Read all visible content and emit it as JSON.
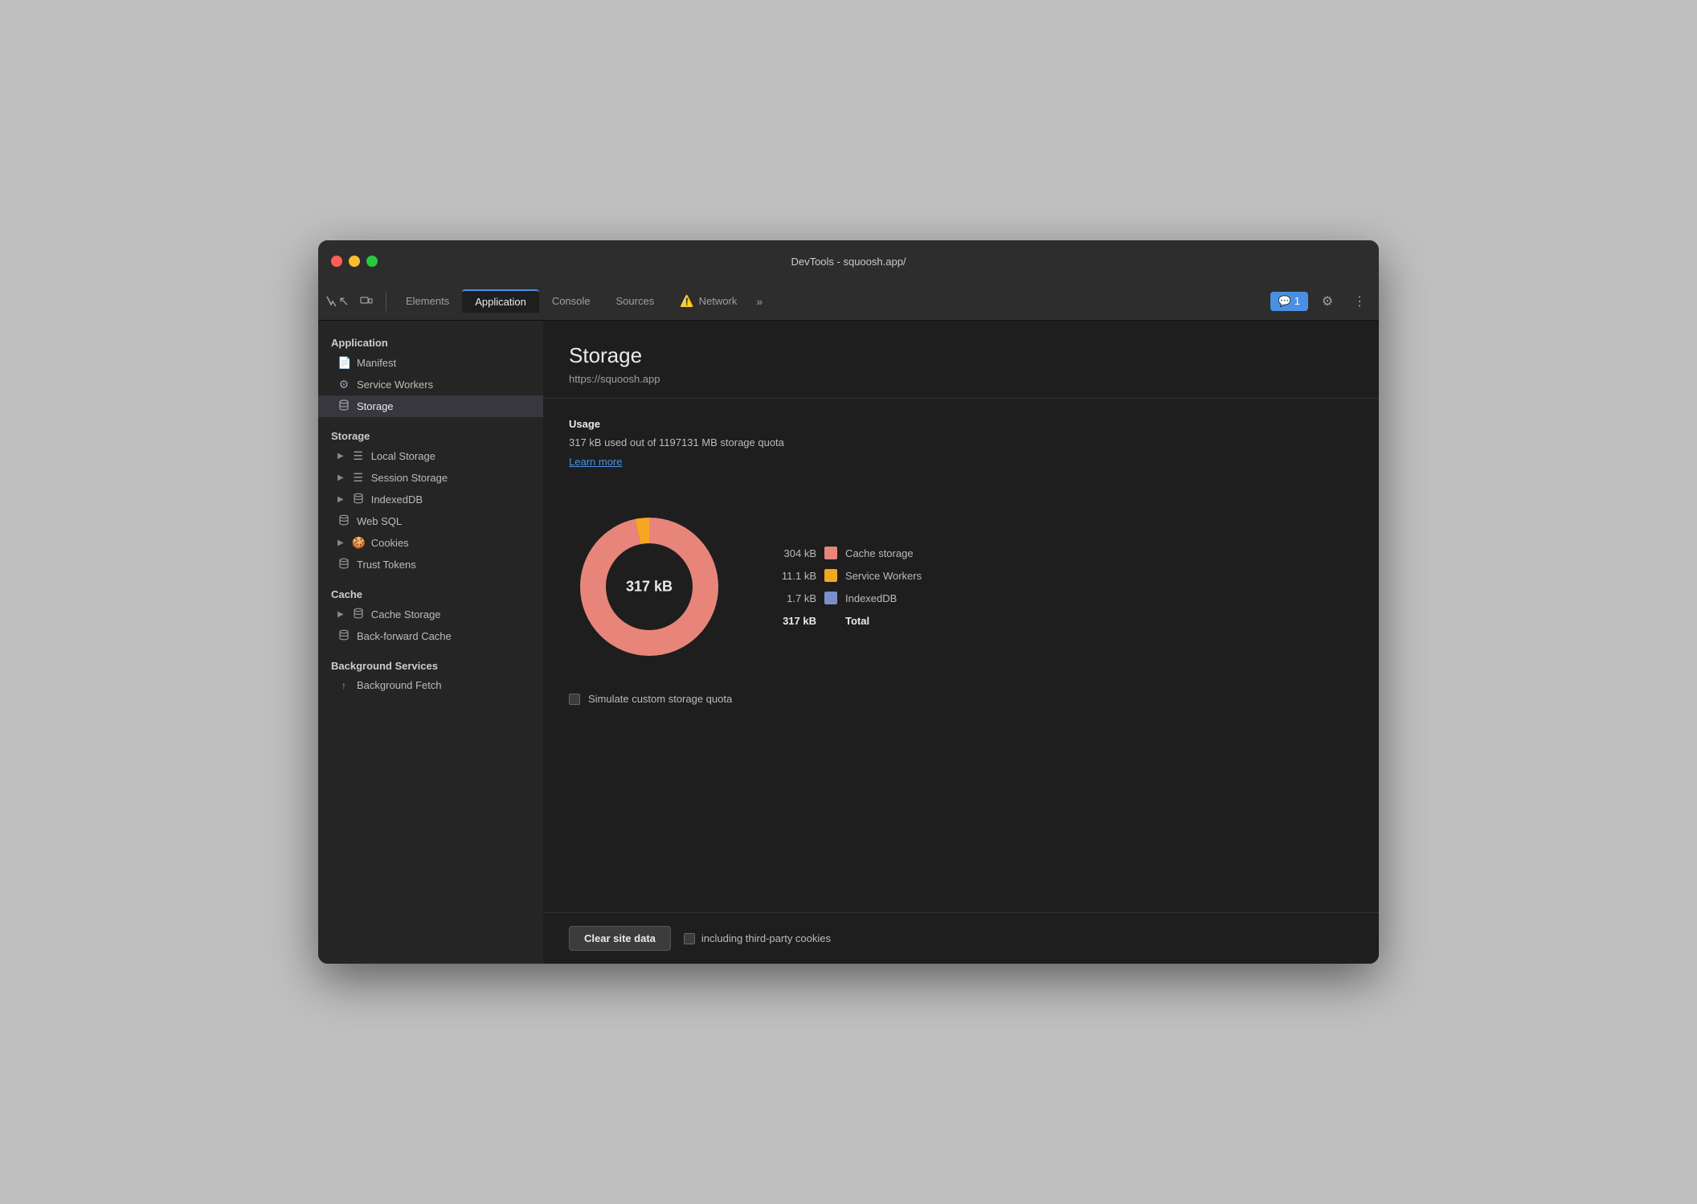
{
  "window": {
    "title": "DevTools - squoosh.app/"
  },
  "toolbar": {
    "tabs": [
      {
        "id": "elements",
        "label": "Elements",
        "active": false,
        "warning": false
      },
      {
        "id": "application",
        "label": "Application",
        "active": true,
        "warning": false
      },
      {
        "id": "console",
        "label": "Console",
        "active": false,
        "warning": false
      },
      {
        "id": "sources",
        "label": "Sources",
        "active": false,
        "warning": false
      },
      {
        "id": "network",
        "label": "Network",
        "active": false,
        "warning": true
      }
    ],
    "more_label": "»",
    "notifications_count": "1",
    "notifications_icon": "💬"
  },
  "sidebar": {
    "sections": [
      {
        "label": "Application",
        "items": [
          {
            "id": "manifest",
            "label": "Manifest",
            "icon": "📄",
            "expandable": false,
            "active": false
          },
          {
            "id": "service-workers",
            "label": "Service Workers",
            "icon": "⚙️",
            "expandable": false,
            "active": false
          },
          {
            "id": "storage-top",
            "label": "Storage",
            "icon": "🗄️",
            "expandable": false,
            "active": true
          }
        ]
      },
      {
        "label": "Storage",
        "items": [
          {
            "id": "local-storage",
            "label": "Local Storage",
            "icon": "☰",
            "expandable": true,
            "active": false
          },
          {
            "id": "session-storage",
            "label": "Session Storage",
            "icon": "☰",
            "expandable": true,
            "active": false
          },
          {
            "id": "indexeddb",
            "label": "IndexedDB",
            "icon": "🗄️",
            "expandable": true,
            "active": false
          },
          {
            "id": "web-sql",
            "label": "Web SQL",
            "icon": "🗄️",
            "expandable": false,
            "active": false
          },
          {
            "id": "cookies",
            "label": "Cookies",
            "icon": "🍪",
            "expandable": true,
            "active": false
          },
          {
            "id": "trust-tokens",
            "label": "Trust Tokens",
            "icon": "🗄️",
            "expandable": false,
            "active": false
          }
        ]
      },
      {
        "label": "Cache",
        "items": [
          {
            "id": "cache-storage",
            "label": "Cache Storage",
            "icon": "🗄️",
            "expandable": true,
            "active": false
          },
          {
            "id": "back-forward-cache",
            "label": "Back-forward Cache",
            "icon": "🗄️",
            "expandable": false,
            "active": false
          }
        ]
      },
      {
        "label": "Background Services",
        "items": [
          {
            "id": "background-fetch",
            "label": "Background Fetch",
            "icon": "↑",
            "expandable": false,
            "active": false
          }
        ]
      }
    ]
  },
  "content": {
    "title": "Storage",
    "url": "https://squoosh.app",
    "usage_label": "Usage",
    "usage_text": "317 kB used out of 1197131 MB storage quota",
    "learn_more": "Learn more",
    "donut_center": "317 kB",
    "legend": [
      {
        "value": "304 kB",
        "color": "#e8857a",
        "label": "Cache storage",
        "total": false
      },
      {
        "value": "11.1 kB",
        "color": "#f5a623",
        "label": "Service Workers",
        "total": false
      },
      {
        "value": "1.7 kB",
        "color": "#7b8ec8",
        "label": "IndexedDB",
        "total": false
      },
      {
        "value": "317 kB",
        "color": "",
        "label": "Total",
        "total": true
      }
    ],
    "simulate_checkbox_label": "Simulate custom storage quota",
    "clear_button_label": "Clear site data",
    "third_party_checkbox_label": "including third-party cookies"
  }
}
